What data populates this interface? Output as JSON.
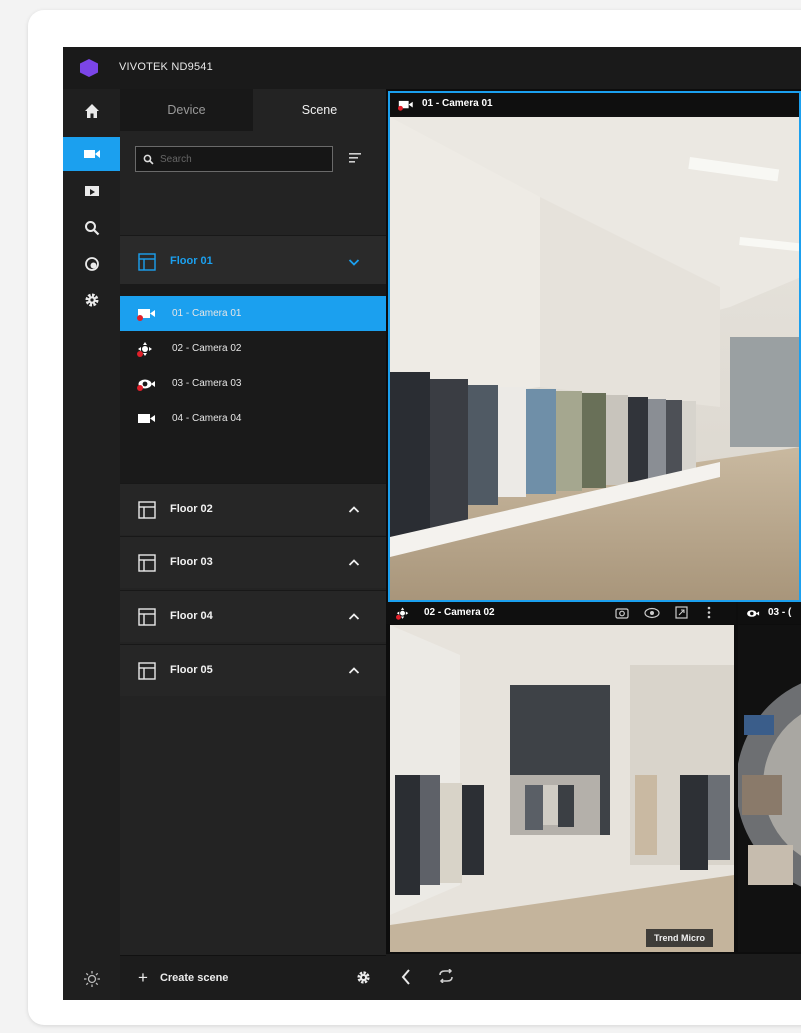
{
  "app": {
    "title": "VIVOTEK ND9541"
  },
  "colors": {
    "accent": "#1ba0ef",
    "logo": "#7b45e8",
    "alert_dot": "#e0202a"
  },
  "rail": {
    "items": [
      {
        "icon": "home-icon"
      },
      {
        "icon": "live-view-icon",
        "active": true
      },
      {
        "icon": "playback-icon"
      },
      {
        "icon": "search-icon"
      },
      {
        "icon": "events-icon"
      },
      {
        "icon": "settings-icon"
      }
    ],
    "bottom_icon": "brightness-icon"
  },
  "tabs": [
    {
      "label": "Device"
    },
    {
      "label": "Scene",
      "active": true
    }
  ],
  "search": {
    "placeholder": "Search"
  },
  "floors": [
    {
      "label": "Floor 01",
      "expanded": true
    },
    {
      "label": "Floor 02"
    },
    {
      "label": "Floor 03"
    },
    {
      "label": "Floor 04"
    },
    {
      "label": "Floor 05"
    }
  ],
  "cameras": [
    {
      "label": "01 - Camera 01",
      "icon": "bullet-camera-icon",
      "active": true
    },
    {
      "label": "02 - Camera 02",
      "icon": "ptz-camera-icon"
    },
    {
      "label": "03 - Camera 03",
      "icon": "fisheye-camera-icon"
    },
    {
      "label": "04 - Camera 04",
      "icon": "bullet-camera-icon"
    }
  ],
  "footer": {
    "create_label": "Create scene"
  },
  "view": {
    "tile1_title": "01 - Camera 01",
    "tile2_title": "02 - Camera 02",
    "tile3_title": "03 - (",
    "overlay_tag": "Trend Micro"
  }
}
